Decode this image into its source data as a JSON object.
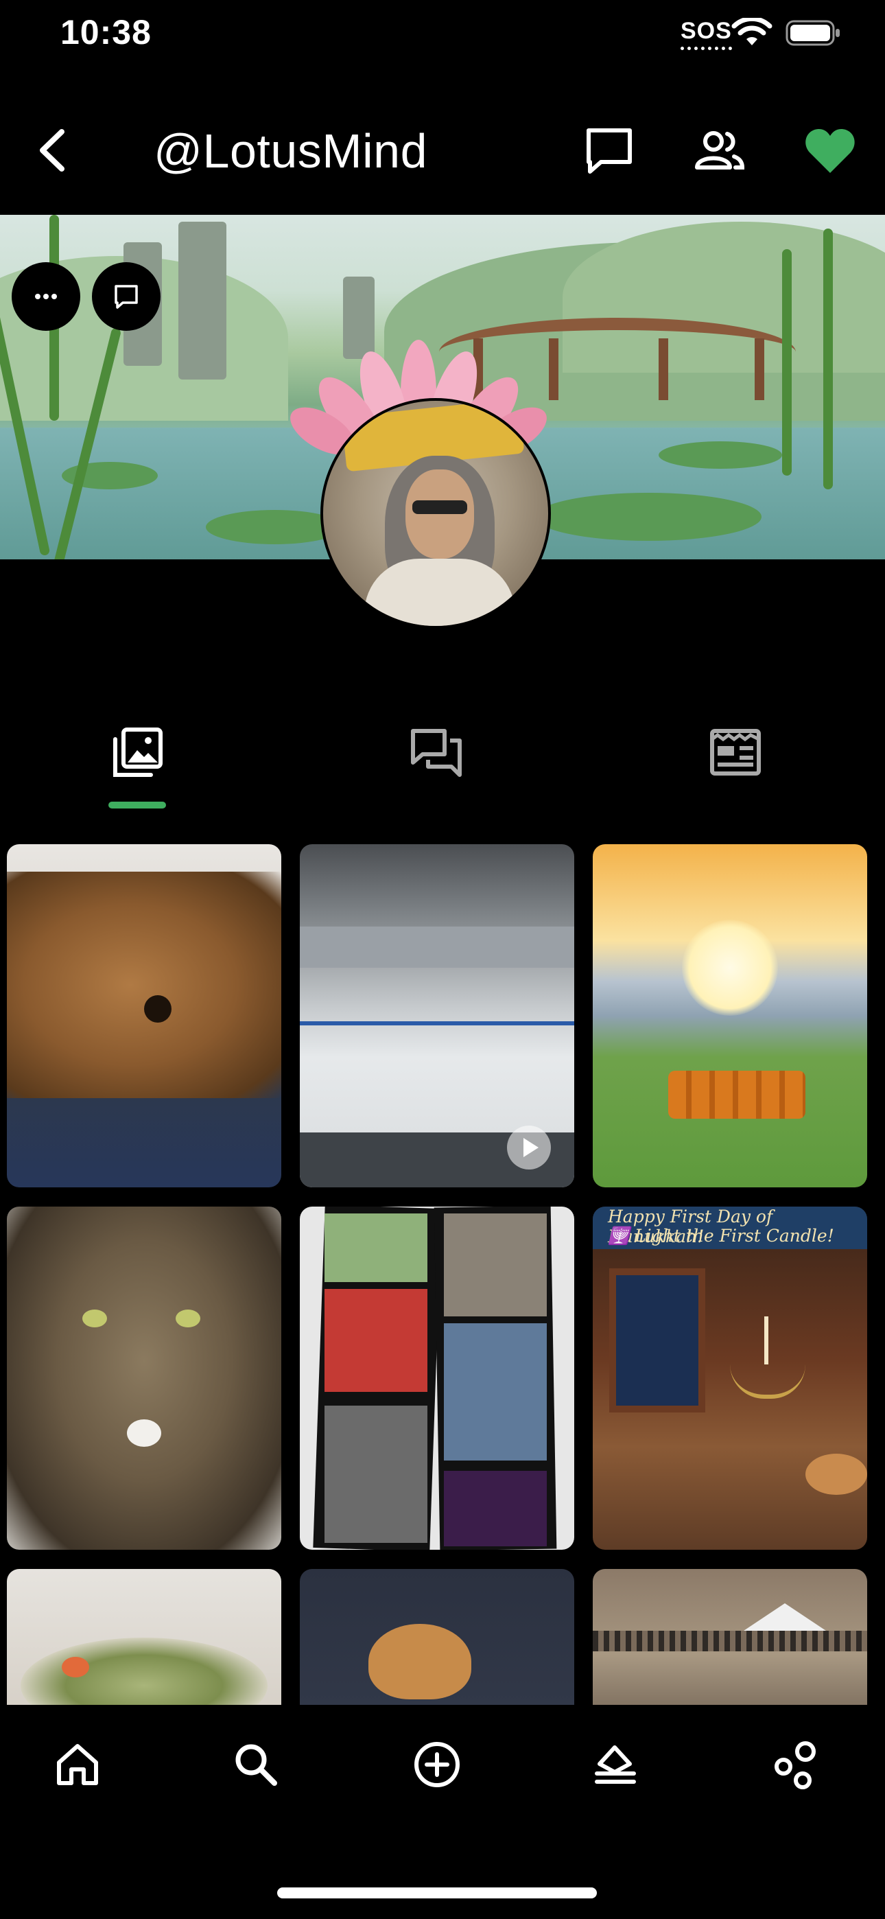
{
  "status_bar": {
    "time": "10:38",
    "sos": "SOS"
  },
  "header": {
    "username": "@LotusMind"
  },
  "banner": {
    "more_button": "more-options",
    "message_button": "message"
  },
  "tabs": [
    {
      "name": "photos",
      "active": true
    },
    {
      "name": "discussions",
      "active": false
    },
    {
      "name": "articles",
      "active": false
    }
  ],
  "grid": {
    "tiles": [
      {
        "label": "Dog lying on a couch",
        "type": "photo"
      },
      {
        "label": "Ice hockey game video",
        "type": "video"
      },
      {
        "label": "Monks walking toward a sunrise with peace and om symbols",
        "type": "photo"
      },
      {
        "label": "Tabby cat portrait",
        "type": "photo"
      },
      {
        "label": "Photo collage of children",
        "type": "photo"
      },
      {
        "label": "Hanukkah menorah by a window",
        "type": "photo",
        "caption_line1": "Happy First Day of Hanukkah!",
        "caption_line2": "🕎 Light the First Candle!"
      },
      {
        "label": "Bowl of food",
        "type": "photo"
      },
      {
        "label": "Dog in a room",
        "type": "photo"
      },
      {
        "label": "Outdoor market street",
        "type": "photo"
      }
    ]
  },
  "colors": {
    "accent": "#3fae5f",
    "background": "#000000",
    "heart": "#3fae5f"
  },
  "bottom_nav": [
    {
      "name": "home"
    },
    {
      "name": "search"
    },
    {
      "name": "create"
    },
    {
      "name": "stack"
    },
    {
      "name": "connections"
    }
  ]
}
